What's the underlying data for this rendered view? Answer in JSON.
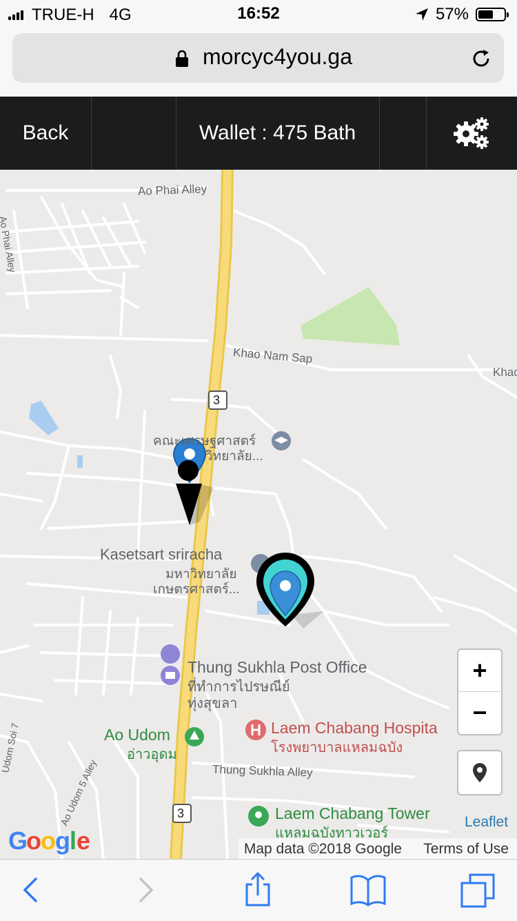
{
  "status_bar": {
    "carrier": "TRUE-H",
    "network": "4G",
    "time": "16:52",
    "battery_percent": "57%",
    "battery_level": 0.57,
    "icons": [
      "signal-bars-icon",
      "location-arrow-icon",
      "battery-icon"
    ]
  },
  "browser": {
    "url": "morcyc4you.ga",
    "icons": [
      "lock-icon",
      "reload-icon"
    ]
  },
  "app_header": {
    "back_label": "Back",
    "wallet_label": "Wallet : 475 Bath",
    "settings_icon": "gears-icon"
  },
  "map": {
    "labels": {
      "ao_phai_alley_top": "Ao Phai Alley",
      "ao_phai_alley_left": "Ao Phai Alley",
      "khao_nam_sap": "Khao Nam Sap",
      "khao_cut": "Khac",
      "route_3": "3",
      "faculty_thai": "คณะเศรษฐศาสตร์",
      "faculty_thai_2": "วิทยาลัย...",
      "kasetsart_en": "Kasetsart sriracha",
      "kasetsart_th1": "มหาวิทยาลัย",
      "kasetsart_th2": "เกษตรศาสตร์...",
      "post_office_en": "Thung Sukhla Post Office",
      "post_office_th1": "ที่ทำการไปรษณีย์",
      "post_office_th2": "ทุ่งสุขลา",
      "ao_udom_en": "Ao Udom",
      "ao_udom_th": "อ่าวอุดม",
      "hospital_en": "Laem Chabang Hospita",
      "hospital_th": "โรงพยาบาลแหลมฉบัง",
      "thung_sukhla_alley": "Thung Sukhla Alley",
      "ao_udom_soi7": "Udom Soi 7",
      "ao_udom_5_alley": "Ao Udom 5 Alley",
      "tower_en": "Laem Chabang Tower",
      "tower_th": "แหลมฉบังทาวเวอร์"
    },
    "controls": {
      "zoom_in": "+",
      "zoom_out": "−"
    },
    "leaflet_link": "Leaflet",
    "map_data": "Map data ©2018 Google",
    "terms": "Terms of Use",
    "google_logo": "Google",
    "colors": {
      "road_major": "#f6d26b",
      "park": "#c8e6b0",
      "water": "#9cc7ee",
      "background": "#ecebea"
    }
  },
  "safari_toolbar": {
    "icons": [
      "back-chevron-icon",
      "forward-chevron-icon",
      "share-icon",
      "bookmarks-icon",
      "tabs-icon"
    ]
  }
}
